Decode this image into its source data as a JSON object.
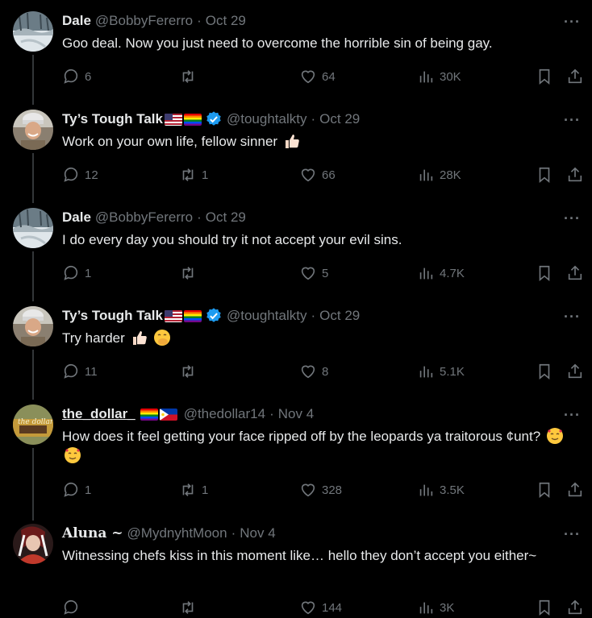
{
  "tweets": [
    {
      "name": "Dale",
      "handle": "@BobbyFererro",
      "date": "Oct 29",
      "flags": [],
      "verified": false,
      "text": "Goo deal. Now you just need to overcome the horrible sin of being gay.",
      "replies": "6",
      "retweets": "",
      "likes": "64",
      "views": "30K",
      "avatar": "snow"
    },
    {
      "name": "Ty’s Tough Talk",
      "handle": "@toughtalkty",
      "date": "Oct 29",
      "flags": [
        "us-flag",
        "rainbow-flag"
      ],
      "verified": true,
      "text": "Work on your own life, fellow sinner",
      "emojis": [
        "thumbs-up"
      ],
      "replies": "12",
      "retweets": "1",
      "likes": "66",
      "views": "28K",
      "avatar": "man"
    },
    {
      "name": "Dale",
      "handle": "@BobbyFererro",
      "date": "Oct 29",
      "flags": [],
      "verified": false,
      "text": "I do every day you should try it not accept your evil sins.",
      "replies": "1",
      "retweets": "",
      "likes": "5",
      "views": "4.7K",
      "avatar": "snow"
    },
    {
      "name": "Ty’s Tough Talk",
      "handle": "@toughtalkty",
      "date": "Oct 29",
      "flags": [
        "us-flag",
        "rainbow-flag"
      ],
      "verified": true,
      "text": "Try harder",
      "emojis": [
        "thumbs-up",
        "hand-over-mouth"
      ],
      "replies": "11",
      "retweets": "",
      "likes": "8",
      "views": "5.1K",
      "avatar": "man"
    },
    {
      "name": "the_dollar_",
      "handle": "@thedollar14",
      "date": "Nov 4",
      "flags": [
        "rainbow-flag",
        "philippines-flag"
      ],
      "verified": false,
      "text": "How does it feel getting your face ripped off by the leopards ya traitorous ¢unt?",
      "emojis": [
        "smiling-hearts",
        "smiling-hearts"
      ],
      "replies": "1",
      "retweets": "1",
      "likes": "328",
      "views": "3.5K",
      "avatar": "dollar"
    },
    {
      "name": "Aluna ~",
      "handle": "@MydnyhtMoon",
      "date": "Nov 4",
      "flags": [],
      "verified": false,
      "text": "Witnessing chefs kiss in this moment like… hello they don’t accept you either~",
      "replies": "",
      "retweets": "",
      "likes": "144",
      "views": "3K",
      "avatar": "aluna"
    }
  ],
  "more_label": "···",
  "colors": {
    "background": "#000000",
    "text": "#e7e9ea",
    "muted": "#71767b",
    "verified": "#1d9bf0",
    "thread_line": "#333639"
  }
}
